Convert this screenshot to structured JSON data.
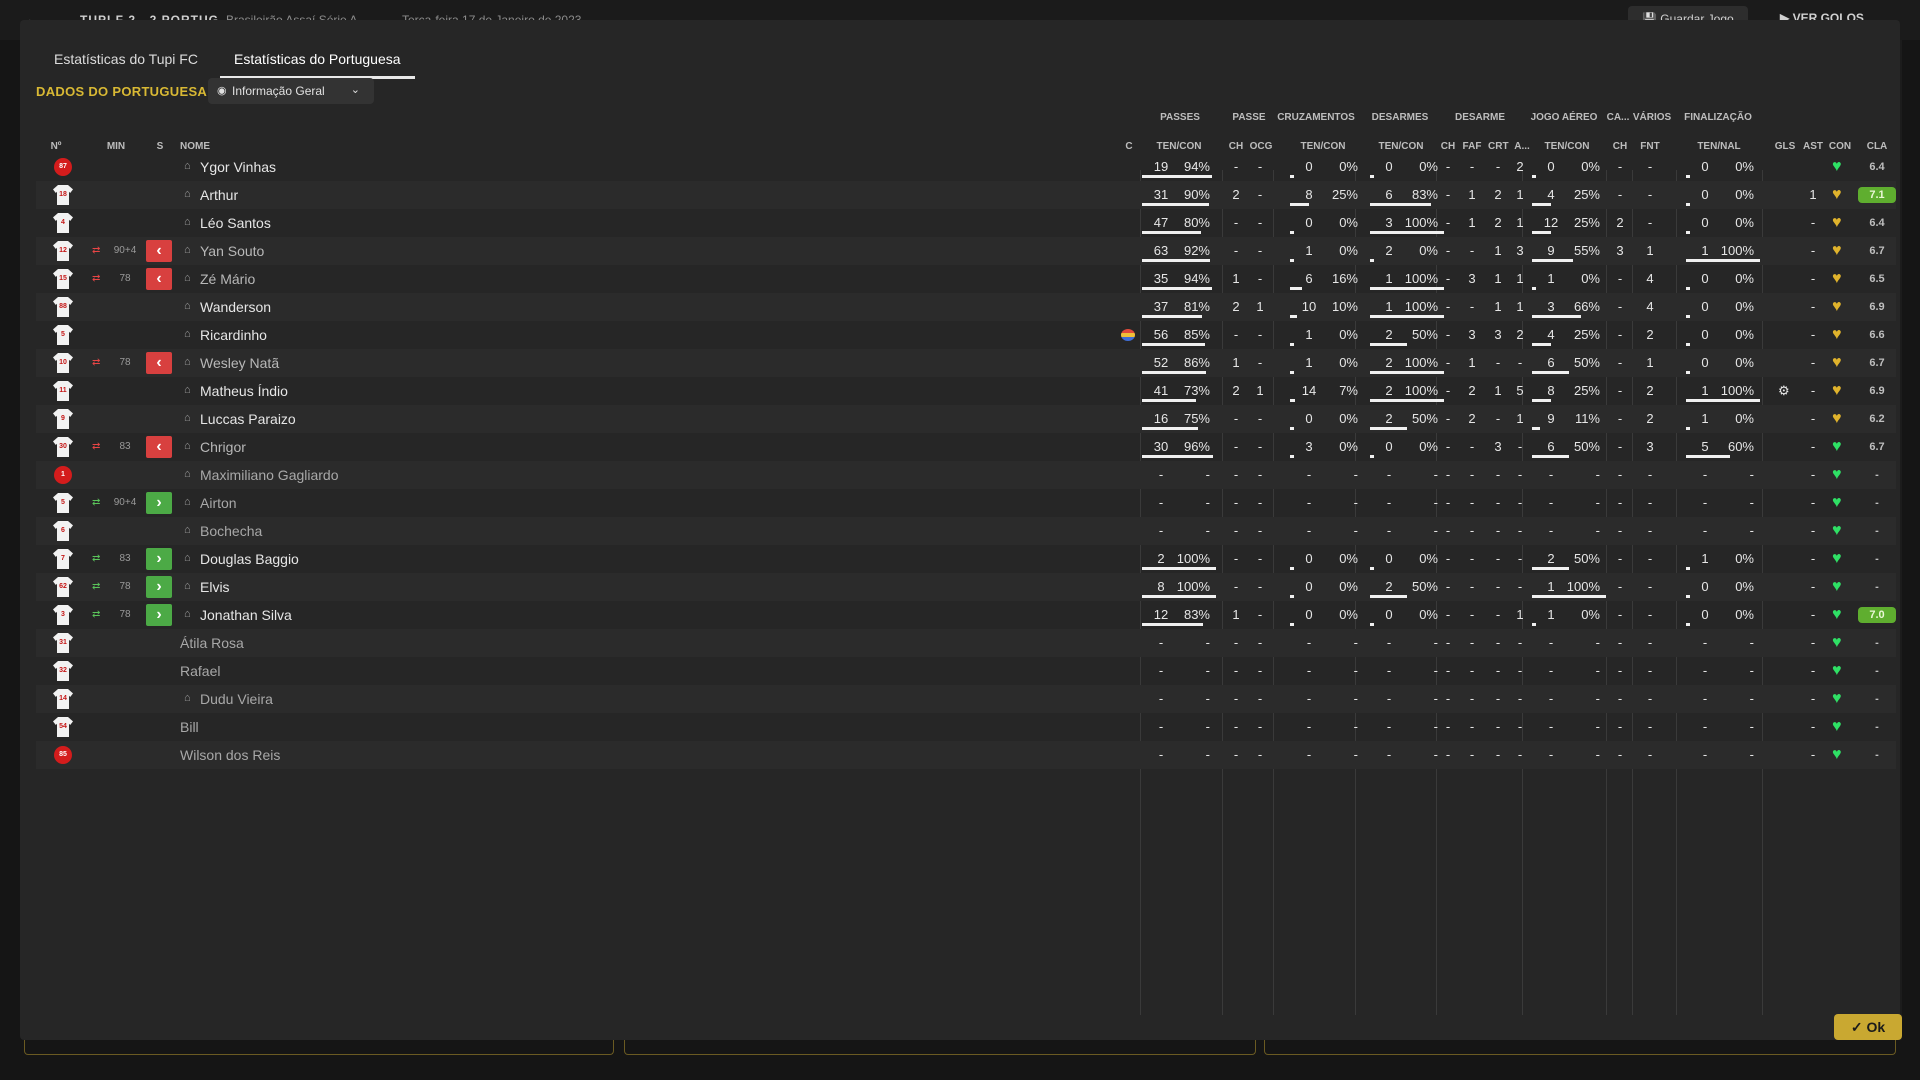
{
  "top_bar": {
    "back_icon": "arrow-left-icon",
    "score": "TUPI F  2 - 2  PORTUG",
    "competition": "Brasileirão Assaí Série A",
    "date": "Terça-feira 17 de Janeiro de 2023",
    "save_label": "Guardar Jogo",
    "goals_label": "VER GOLOS"
  },
  "tabs": [
    {
      "label": "Estatísticas do Tupi FC",
      "active": false
    },
    {
      "label": "Estatísticas do Portuguesa",
      "active": true
    }
  ],
  "section_title": "DADOS DO PORTUGUESA",
  "view_dropdown": {
    "label": "Informação Geral",
    "icon": "eye-icon"
  },
  "group_headers": [
    "PASSES",
    "PASSE",
    "CRUZAMENTOS",
    "DESARMES",
    "DESARME",
    "JOGO AÉREO",
    "CA...",
    "VÁRIOS",
    "FINALIZAÇÃO"
  ],
  "column_headers": {
    "num": "Nº",
    "min": "MIN",
    "s": "S",
    "name": "NOME",
    "c": "C",
    "passes": "TEN/CON",
    "passe_ch": "CH",
    "passe_ocg": "OCG",
    "cruz": "TEN/CON",
    "desarmes": "TEN/CON",
    "desarme_ch": "CH",
    "desarme_faf": "FAF",
    "desarme_crt": "CRT",
    "desarme_a": "A...",
    "aereo": "TEN/CON",
    "ca_ch": "CH",
    "varios_fnt": "FNT",
    "final": "TEN/NAL",
    "gls": "GLS",
    "ast": "AST",
    "con": "CON",
    "cla": "CLA"
  },
  "players": [
    {
      "num": "87",
      "gk": true,
      "sub": "",
      "min": "",
      "name": "Ygor Vinhas",
      "person": true,
      "c": "",
      "pass_t": "19",
      "pass_p": "94%",
      "pass_f": 0.94,
      "ch": "-",
      "ocg": "-",
      "cr_t": "0",
      "cr_p": "0%",
      "cr_f": 0,
      "de_t": "0",
      "de_p": "0%",
      "de_f": 0,
      "d_ch": "-",
      "faf": "-",
      "crt": "-",
      "a": "2",
      "ae_t": "0",
      "ae_p": "0%",
      "ae_f": 0,
      "ca": "-",
      "fnt": "-",
      "fi_t": "0",
      "fi_p": "0%",
      "fi_f": 0,
      "gls": "",
      "ast": "",
      "con": "green",
      "cla": "6.4",
      "cla_hi": false
    },
    {
      "num": "18",
      "gk": false,
      "sub": "",
      "min": "",
      "name": "Arthur",
      "person": true,
      "c": "",
      "pass_t": "31",
      "pass_p": "90%",
      "pass_f": 0.9,
      "ch": "2",
      "ocg": "-",
      "cr_t": "8",
      "cr_p": "25%",
      "cr_f": 0.25,
      "de_t": "6",
      "de_p": "83%",
      "de_f": 0.83,
      "d_ch": "-",
      "faf": "1",
      "crt": "2",
      "a": "1",
      "ae_t": "4",
      "ae_p": "25%",
      "ae_f": 0.25,
      "ca": "-",
      "fnt": "-",
      "fi_t": "0",
      "fi_p": "0%",
      "fi_f": 0,
      "gls": "",
      "ast": "1",
      "con": "gold",
      "cla": "7.1",
      "cla_hi": true
    },
    {
      "num": "4",
      "gk": false,
      "sub": "",
      "min": "",
      "name": "Léo Santos",
      "person": true,
      "c": "",
      "pass_t": "47",
      "pass_p": "80%",
      "pass_f": 0.8,
      "ch": "-",
      "ocg": "-",
      "cr_t": "0",
      "cr_p": "0%",
      "cr_f": 0,
      "de_t": "3",
      "de_p": "100%",
      "de_f": 1,
      "d_ch": "-",
      "faf": "1",
      "crt": "2",
      "a": "1",
      "ae_t": "12",
      "ae_p": "25%",
      "ae_f": 0.25,
      "ca": "2",
      "fnt": "-",
      "fi_t": "0",
      "fi_p": "0%",
      "fi_f": 0,
      "gls": "",
      "ast": "-",
      "con": "gold",
      "cla": "6.4",
      "cla_hi": false
    },
    {
      "num": "12",
      "gk": false,
      "sub": "off",
      "min": "90+4",
      "name": "Yan Souto",
      "person": true,
      "c": "",
      "pass_t": "63",
      "pass_p": "92%",
      "pass_f": 0.92,
      "ch": "-",
      "ocg": "-",
      "cr_t": "1",
      "cr_p": "0%",
      "cr_f": 0,
      "de_t": "2",
      "de_p": "0%",
      "de_f": 0,
      "d_ch": "-",
      "faf": "-",
      "crt": "1",
      "a": "3",
      "ae_t": "9",
      "ae_p": "55%",
      "ae_f": 0.55,
      "ca": "3",
      "fnt": "1",
      "fi_t": "1",
      "fi_p": "100%",
      "fi_f": 1,
      "gls": "",
      "ast": "-",
      "con": "gold",
      "cla": "6.7",
      "cla_hi": false
    },
    {
      "num": "15",
      "gk": false,
      "sub": "off",
      "min": "78",
      "name": "Zé Mário",
      "person": true,
      "c": "",
      "pass_t": "35",
      "pass_p": "94%",
      "pass_f": 0.94,
      "ch": "1",
      "ocg": "-",
      "cr_t": "6",
      "cr_p": "16%",
      "cr_f": 0.16,
      "de_t": "1",
      "de_p": "100%",
      "de_f": 1,
      "d_ch": "-",
      "faf": "3",
      "crt": "1",
      "a": "1",
      "ae_t": "1",
      "ae_p": "0%",
      "ae_f": 0,
      "ca": "-",
      "fnt": "4",
      "fi_t": "0",
      "fi_p": "0%",
      "fi_f": 0,
      "gls": "",
      "ast": "-",
      "con": "gold",
      "cla": "6.5",
      "cla_hi": false
    },
    {
      "num": "88",
      "gk": false,
      "sub": "",
      "min": "",
      "name": "Wanderson",
      "person": true,
      "c": "",
      "pass_t": "37",
      "pass_p": "81%",
      "pass_f": 0.81,
      "ch": "2",
      "ocg": "1",
      "cr_t": "10",
      "cr_p": "10%",
      "cr_f": 0.1,
      "de_t": "1",
      "de_p": "100%",
      "de_f": 1,
      "d_ch": "-",
      "faf": "-",
      "crt": "1",
      "a": "1",
      "ae_t": "3",
      "ae_p": "66%",
      "ae_f": 0.66,
      "ca": "-",
      "fnt": "4",
      "fi_t": "0",
      "fi_p": "0%",
      "fi_f": 0,
      "gls": "",
      "ast": "-",
      "con": "gold",
      "cla": "6.9",
      "cla_hi": false
    },
    {
      "num": "5",
      "gk": false,
      "sub": "",
      "min": "",
      "name": "Ricardinho",
      "person": true,
      "c": "flag",
      "pass_t": "56",
      "pass_p": "85%",
      "pass_f": 0.85,
      "ch": "-",
      "ocg": "-",
      "cr_t": "1",
      "cr_p": "0%",
      "cr_f": 0,
      "de_t": "2",
      "de_p": "50%",
      "de_f": 0.5,
      "d_ch": "-",
      "faf": "3",
      "crt": "3",
      "a": "2",
      "ae_t": "4",
      "ae_p": "25%",
      "ae_f": 0.25,
      "ca": "-",
      "fnt": "2",
      "fi_t": "0",
      "fi_p": "0%",
      "fi_f": 0,
      "gls": "",
      "ast": "-",
      "con": "gold",
      "cla": "6.6",
      "cla_hi": false
    },
    {
      "num": "10",
      "gk": false,
      "sub": "off",
      "min": "78",
      "name": "Wesley Natã",
      "person": true,
      "c": "",
      "pass_t": "52",
      "pass_p": "86%",
      "pass_f": 0.86,
      "ch": "1",
      "ocg": "-",
      "cr_t": "1",
      "cr_p": "0%",
      "cr_f": 0,
      "de_t": "2",
      "de_p": "100%",
      "de_f": 1,
      "d_ch": "-",
      "faf": "1",
      "crt": "-",
      "a": "-",
      "ae_t": "6",
      "ae_p": "50%",
      "ae_f": 0.5,
      "ca": "-",
      "fnt": "1",
      "fi_t": "0",
      "fi_p": "0%",
      "fi_f": 0,
      "gls": "",
      "ast": "-",
      "con": "gold",
      "cla": "6.7",
      "cla_hi": false
    },
    {
      "num": "11",
      "gk": false,
      "sub": "",
      "min": "",
      "name": "Matheus Índio",
      "person": true,
      "c": "",
      "pass_t": "41",
      "pass_p": "73%",
      "pass_f": 0.73,
      "ch": "2",
      "ocg": "1",
      "cr_t": "14",
      "cr_p": "7%",
      "cr_f": 0.07,
      "de_t": "2",
      "de_p": "100%",
      "de_f": 1,
      "d_ch": "-",
      "faf": "2",
      "crt": "1",
      "a": "5",
      "ae_t": "8",
      "ae_p": "25%",
      "ae_f": 0.25,
      "ca": "-",
      "fnt": "2",
      "fi_t": "1",
      "fi_p": "100%",
      "fi_f": 1,
      "gls": "gear",
      "ast": "-",
      "con": "gold",
      "cla": "6.9",
      "cla_hi": false
    },
    {
      "num": "9",
      "gk": false,
      "sub": "",
      "min": "",
      "name": "Luccas Paraizo",
      "person": true,
      "c": "",
      "pass_t": "16",
      "pass_p": "75%",
      "pass_f": 0.75,
      "ch": "-",
      "ocg": "-",
      "cr_t": "0",
      "cr_p": "0%",
      "cr_f": 0,
      "de_t": "2",
      "de_p": "50%",
      "de_f": 0.5,
      "d_ch": "-",
      "faf": "2",
      "crt": "-",
      "a": "1",
      "ae_t": "9",
      "ae_p": "11%",
      "ae_f": 0.11,
      "ca": "-",
      "fnt": "2",
      "fi_t": "1",
      "fi_p": "0%",
      "fi_f": 0,
      "gls": "",
      "ast": "-",
      "con": "gold",
      "cla": "6.2",
      "cla_hi": false
    },
    {
      "num": "30",
      "gk": false,
      "sub": "off",
      "min": "83",
      "name": "Chrigor",
      "person": true,
      "c": "",
      "pass_t": "30",
      "pass_p": "96%",
      "pass_f": 0.96,
      "ch": "-",
      "ocg": "-",
      "cr_t": "3",
      "cr_p": "0%",
      "cr_f": 0,
      "de_t": "0",
      "de_p": "0%",
      "de_f": 0,
      "d_ch": "-",
      "faf": "-",
      "crt": "3",
      "a": "-",
      "ae_t": "6",
      "ae_p": "50%",
      "ae_f": 0.5,
      "ca": "-",
      "fnt": "3",
      "fi_t": "5",
      "fi_p": "60%",
      "fi_f": 0.6,
      "gls": "",
      "ast": "-",
      "con": "green",
      "cla": "6.7",
      "cla_hi": false
    },
    {
      "num": "1",
      "gk": true,
      "sub": "",
      "min": "",
      "name": "Maximiliano Gagliardo",
      "person": true,
      "c": "",
      "pass_t": "-",
      "pass_p": "-",
      "pass_f": 0,
      "ch": "-",
      "ocg": "-",
      "cr_t": "-",
      "cr_p": "-",
      "cr_f": 0,
      "de_t": "-",
      "de_p": "-",
      "de_f": 0,
      "d_ch": "-",
      "faf": "-",
      "crt": "-",
      "a": "-",
      "ae_t": "-",
      "ae_p": "-",
      "ae_f": 0,
      "ca": "-",
      "fnt": "-",
      "fi_t": "-",
      "fi_p": "-",
      "fi_f": 0,
      "gls": "",
      "ast": "-",
      "con": "green",
      "cla": "-",
      "cla_hi": false
    },
    {
      "num": "5",
      "gk": false,
      "sub": "on",
      "min": "90+4",
      "name": "Airton",
      "person": true,
      "c": "",
      "pass_t": "-",
      "pass_p": "-",
      "pass_f": 0,
      "ch": "-",
      "ocg": "-",
      "cr_t": "-",
      "cr_p": "-",
      "cr_f": 0,
      "de_t": "-",
      "de_p": "-",
      "de_f": 0,
      "d_ch": "-",
      "faf": "-",
      "crt": "-",
      "a": "-",
      "ae_t": "-",
      "ae_p": "-",
      "ae_f": 0,
      "ca": "-",
      "fnt": "-",
      "fi_t": "-",
      "fi_p": "-",
      "fi_f": 0,
      "gls": "",
      "ast": "-",
      "con": "green",
      "cla": "-",
      "cla_hi": false
    },
    {
      "num": "6",
      "gk": false,
      "sub": "",
      "min": "",
      "name": "Bochecha",
      "person": true,
      "c": "",
      "pass_t": "-",
      "pass_p": "-",
      "pass_f": 0,
      "ch": "-",
      "ocg": "-",
      "cr_t": "-",
      "cr_p": "-",
      "cr_f": 0,
      "de_t": "-",
      "de_p": "-",
      "de_f": 0,
      "d_ch": "-",
      "faf": "-",
      "crt": "-",
      "a": "-",
      "ae_t": "-",
      "ae_p": "-",
      "ae_f": 0,
      "ca": "-",
      "fnt": "-",
      "fi_t": "-",
      "fi_p": "-",
      "fi_f": 0,
      "gls": "",
      "ast": "-",
      "con": "green",
      "cla": "-",
      "cla_hi": false
    },
    {
      "num": "7",
      "gk": false,
      "sub": "on",
      "min": "83",
      "name": "Douglas Baggio",
      "person": true,
      "c": "",
      "pass_t": "2",
      "pass_p": "100%",
      "pass_f": 1,
      "ch": "-",
      "ocg": "-",
      "cr_t": "0",
      "cr_p": "0%",
      "cr_f": 0,
      "de_t": "0",
      "de_p": "0%",
      "de_f": 0,
      "d_ch": "-",
      "faf": "-",
      "crt": "-",
      "a": "-",
      "ae_t": "2",
      "ae_p": "50%",
      "ae_f": 0.5,
      "ca": "-",
      "fnt": "-",
      "fi_t": "1",
      "fi_p": "0%",
      "fi_f": 0,
      "gls": "",
      "ast": "-",
      "con": "green",
      "cla": "-",
      "cla_hi": false
    },
    {
      "num": "62",
      "gk": false,
      "sub": "on",
      "min": "78",
      "name": "Elvis",
      "person": true,
      "c": "",
      "pass_t": "8",
      "pass_p": "100%",
      "pass_f": 1,
      "ch": "-",
      "ocg": "-",
      "cr_t": "0",
      "cr_p": "0%",
      "cr_f": 0,
      "de_t": "2",
      "de_p": "50%",
      "de_f": 0.5,
      "d_ch": "-",
      "faf": "-",
      "crt": "-",
      "a": "-",
      "ae_t": "1",
      "ae_p": "100%",
      "ae_f": 1,
      "ca": "-",
      "fnt": "-",
      "fi_t": "0",
      "fi_p": "0%",
      "fi_f": 0,
      "gls": "",
      "ast": "-",
      "con": "green",
      "cla": "-",
      "cla_hi": false
    },
    {
      "num": "3",
      "gk": false,
      "sub": "on",
      "min": "78",
      "name": "Jonathan Silva",
      "person": true,
      "c": "",
      "pass_t": "12",
      "pass_p": "83%",
      "pass_f": 0.83,
      "ch": "1",
      "ocg": "-",
      "cr_t": "0",
      "cr_p": "0%",
      "cr_f": 0,
      "de_t": "0",
      "de_p": "0%",
      "de_f": 0,
      "d_ch": "-",
      "faf": "-",
      "crt": "-",
      "a": "1",
      "ae_t": "1",
      "ae_p": "0%",
      "ae_f": 0,
      "ca": "-",
      "fnt": "-",
      "fi_t": "0",
      "fi_p": "0%",
      "fi_f": 0,
      "gls": "",
      "ast": "-",
      "con": "green",
      "cla": "7.0",
      "cla_hi": true
    },
    {
      "num": "31",
      "gk": false,
      "sub": "",
      "min": "",
      "name": "Átila Rosa",
      "person": false,
      "c": "",
      "pass_t": "-",
      "pass_p": "-",
      "pass_f": 0,
      "ch": "-",
      "ocg": "-",
      "cr_t": "-",
      "cr_p": "-",
      "cr_f": 0,
      "de_t": "-",
      "de_p": "-",
      "de_f": 0,
      "d_ch": "-",
      "faf": "-",
      "crt": "-",
      "a": "-",
      "ae_t": "-",
      "ae_p": "-",
      "ae_f": 0,
      "ca": "-",
      "fnt": "-",
      "fi_t": "-",
      "fi_p": "-",
      "fi_f": 0,
      "gls": "",
      "ast": "-",
      "con": "green",
      "cla": "-",
      "cla_hi": false
    },
    {
      "num": "32",
      "gk": false,
      "sub": "",
      "min": "",
      "name": "Rafael",
      "person": false,
      "c": "",
      "pass_t": "-",
      "pass_p": "-",
      "pass_f": 0,
      "ch": "-",
      "ocg": "-",
      "cr_t": "-",
      "cr_p": "-",
      "cr_f": 0,
      "de_t": "-",
      "de_p": "-",
      "de_f": 0,
      "d_ch": "-",
      "faf": "-",
      "crt": "-",
      "a": "-",
      "ae_t": "-",
      "ae_p": "-",
      "ae_f": 0,
      "ca": "-",
      "fnt": "-",
      "fi_t": "-",
      "fi_p": "-",
      "fi_f": 0,
      "gls": "",
      "ast": "-",
      "con": "green",
      "cla": "-",
      "cla_hi": false
    },
    {
      "num": "14",
      "gk": false,
      "sub": "",
      "min": "",
      "name": "Dudu Vieira",
      "person": true,
      "c": "",
      "pass_t": "-",
      "pass_p": "-",
      "pass_f": 0,
      "ch": "-",
      "ocg": "-",
      "cr_t": "-",
      "cr_p": "-",
      "cr_f": 0,
      "de_t": "-",
      "de_p": "-",
      "de_f": 0,
      "d_ch": "-",
      "faf": "-",
      "crt": "-",
      "a": "-",
      "ae_t": "-",
      "ae_p": "-",
      "ae_f": 0,
      "ca": "-",
      "fnt": "-",
      "fi_t": "-",
      "fi_p": "-",
      "fi_f": 0,
      "gls": "",
      "ast": "-",
      "con": "green",
      "cla": "-",
      "cla_hi": false
    },
    {
      "num": "54",
      "gk": false,
      "sub": "",
      "min": "",
      "name": "Bill",
      "person": false,
      "c": "",
      "pass_t": "-",
      "pass_p": "-",
      "pass_f": 0,
      "ch": "-",
      "ocg": "-",
      "cr_t": "-",
      "cr_p": "-",
      "cr_f": 0,
      "de_t": "-",
      "de_p": "-",
      "de_f": 0,
      "d_ch": "-",
      "faf": "-",
      "crt": "-",
      "a": "-",
      "ae_t": "-",
      "ae_p": "-",
      "ae_f": 0,
      "ca": "-",
      "fnt": "-",
      "fi_t": "-",
      "fi_p": "-",
      "fi_f": 0,
      "gls": "",
      "ast": "-",
      "con": "green",
      "cla": "-",
      "cla_hi": false
    },
    {
      "num": "85",
      "gk": true,
      "sub": "",
      "min": "",
      "name": "Wilson dos Reis",
      "person": false,
      "c": "",
      "pass_t": "-",
      "pass_p": "-",
      "pass_f": 0,
      "ch": "-",
      "ocg": "-",
      "cr_t": "-",
      "cr_p": "-",
      "cr_f": 0,
      "de_t": "-",
      "de_p": "-",
      "de_f": 0,
      "d_ch": "-",
      "faf": "-",
      "crt": "-",
      "a": "-",
      "ae_t": "-",
      "ae_p": "-",
      "ae_f": 0,
      "ca": "-",
      "fnt": "-",
      "fi_t": "-",
      "fi_p": "-",
      "fi_f": 0,
      "gls": "",
      "ast": "-",
      "con": "green",
      "cla": "-",
      "cla_hi": false
    }
  ],
  "ok_label": "Ok",
  "colors": {
    "accent": "#d9b934",
    "sub_off": "#d8403f",
    "sub_on": "#4caa46",
    "rating_high": "#5fae2f",
    "heart_green": "#2fe065",
    "heart_gold": "#e0b32c"
  }
}
